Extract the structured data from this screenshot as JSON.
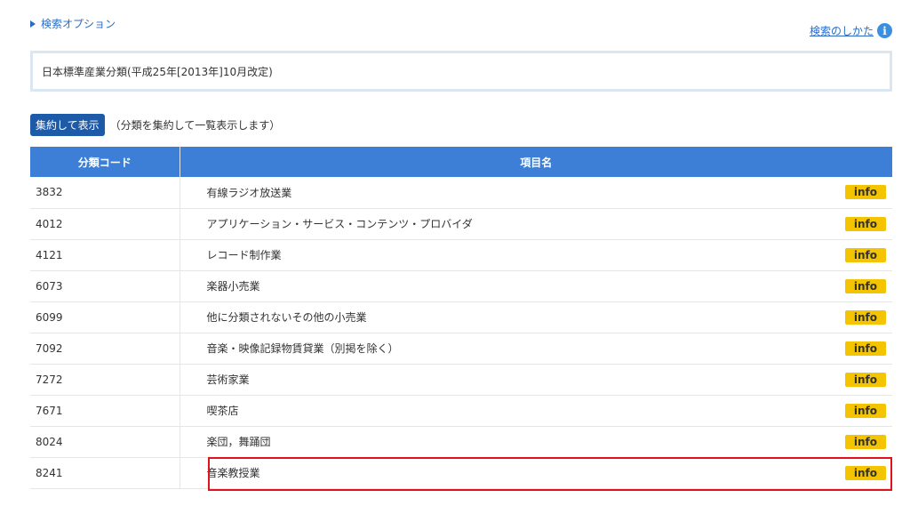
{
  "header": {
    "search_options_label": "検索オプション",
    "howto_label": "検索のしかた"
  },
  "classification": "日本標準産業分類(平成25年[2013年]10月改定)",
  "aggregate": {
    "button_label": "集約して表示",
    "note": "（分類を集約して一覧表示します）"
  },
  "table": {
    "headers": [
      "分類コード",
      "項目名"
    ],
    "info_label": "info",
    "rows": [
      {
        "code": "3832",
        "name": "有線ラジオ放送業"
      },
      {
        "code": "4012",
        "name": "アプリケーション・サービス・コンテンツ・プロバイダ"
      },
      {
        "code": "4121",
        "name": "レコード制作業"
      },
      {
        "code": "6073",
        "name": "楽器小売業"
      },
      {
        "code": "6099",
        "name": "他に分類されないその他の小売業"
      },
      {
        "code": "7092",
        "name": "音楽・映像記録物賃貸業（別掲を除く）"
      },
      {
        "code": "7272",
        "name": "芸術家業"
      },
      {
        "code": "7671",
        "name": "喫茶店"
      },
      {
        "code": "8024",
        "name": "楽団，舞踊団"
      },
      {
        "code": "8241",
        "name": "音楽教授業"
      }
    ]
  },
  "colors": {
    "header_bg": "#3d7fd6",
    "button_bg": "#1d5aa8",
    "info_badge": "#f5c400",
    "highlight": "#e0121b"
  }
}
